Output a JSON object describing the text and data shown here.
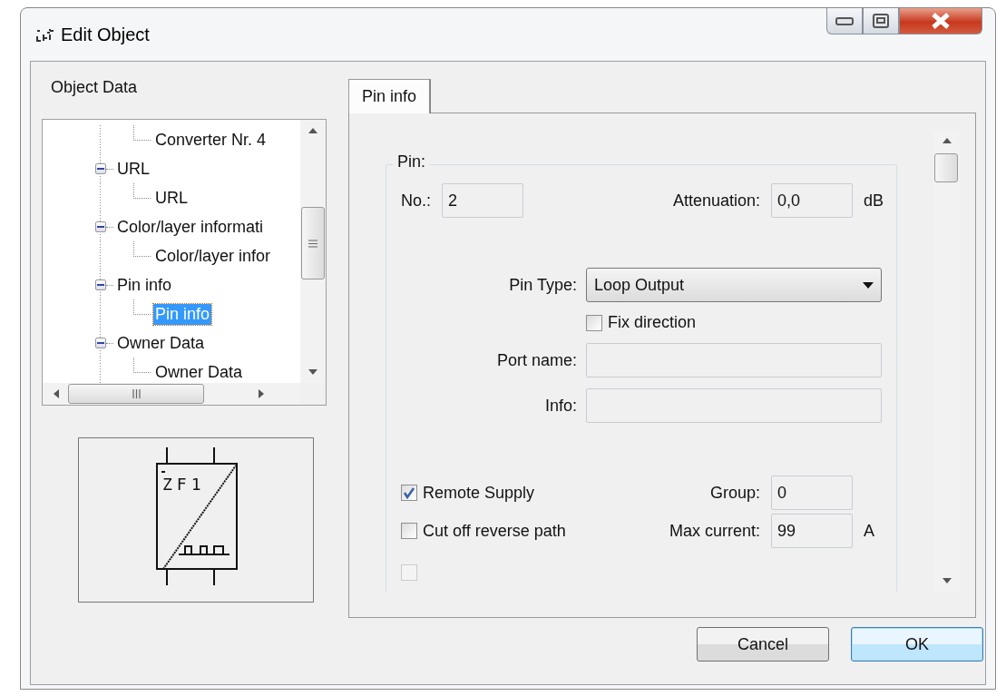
{
  "window": {
    "title": "Edit Object",
    "controls": [
      {
        "kind": "minimize"
      },
      {
        "kind": "maximize"
      },
      {
        "kind": "close"
      }
    ]
  },
  "object_data": {
    "label": "Object Data",
    "tree": [
      {
        "children": [
          {
            "label": "Converter Nr. 4",
            "selected": false
          }
        ]
      },
      {
        "label": "URL",
        "expanded": true,
        "children": [
          {
            "label": "URL",
            "selected": false
          }
        ]
      },
      {
        "label": "Color/layer informati",
        "expanded": true,
        "children": [
          {
            "label": "Color/layer infor",
            "selected": false
          }
        ]
      },
      {
        "label": "Pin info",
        "expanded": true,
        "children": [
          {
            "label": "Pin info",
            "selected": true
          }
        ]
      },
      {
        "label": "Owner Data",
        "expanded": true,
        "children": [
          {
            "label": "Owner Data",
            "selected": false
          }
        ]
      }
    ],
    "preview": {
      "symbol_text": "ZF1"
    }
  },
  "tabs": [
    {
      "label": "Pin info",
      "selected": true
    }
  ],
  "pin_group": {
    "title": "Pin:",
    "no": {
      "label": "No.:",
      "value": "2"
    },
    "attenuation": {
      "label": "Attenuation:",
      "value": "0,0",
      "unit": "dB"
    },
    "pin_type": {
      "label": "Pin Type:",
      "value": "Loop Output"
    },
    "fix_direction": {
      "label": "Fix direction",
      "checked": false
    },
    "port_name": {
      "label": "Port name:"
    },
    "info": {
      "label": "Info:"
    },
    "remote_supply": {
      "label": "Remote Supply",
      "checked": true
    },
    "group": {
      "label": "Group:",
      "value": "0"
    },
    "cut_off_reverse_path": {
      "label": "Cut off reverse path",
      "checked": false
    },
    "max_current": {
      "label": "Max current:",
      "value": "99",
      "unit": "A"
    },
    "cut_checkbox": {
      "checked": false,
      "disabled": true
    }
  },
  "buttons": [
    {
      "label": "Cancel",
      "default": false
    },
    {
      "label": "OK",
      "default": true
    }
  ]
}
